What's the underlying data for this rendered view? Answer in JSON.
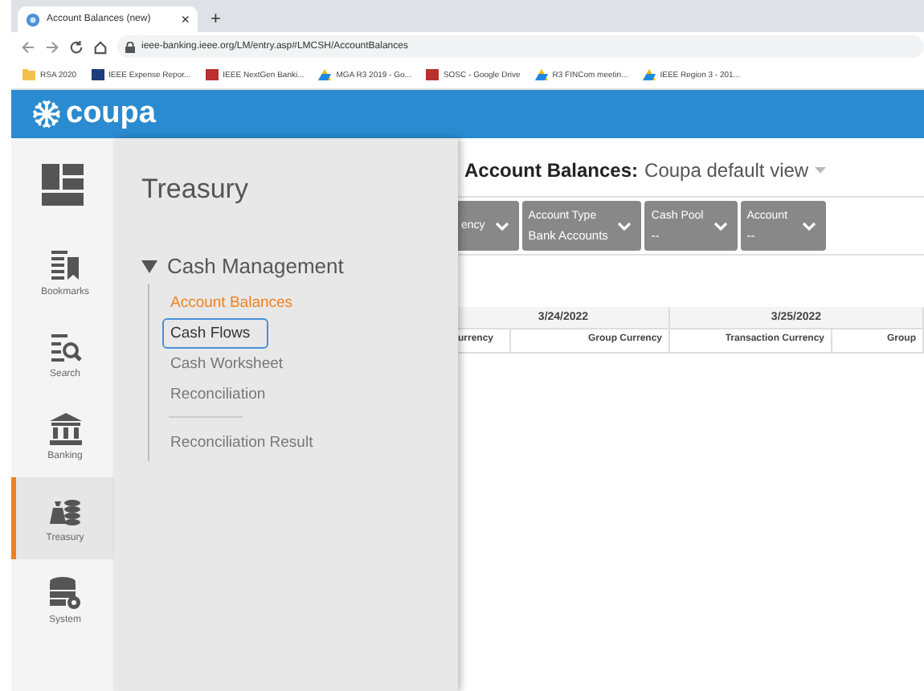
{
  "browser": {
    "tab_title": "Account Balances (new)",
    "tab_close": "×",
    "new_tab": "+",
    "url": "ieee-banking.ieee.org/LM/entry.asp#LMCSH/AccountBalances",
    "bookmarks": [
      {
        "label": "RSA 2020",
        "kind": "folder"
      },
      {
        "label": "IEEE Expense Repor...",
        "kind": "ieee"
      },
      {
        "label": "IEEE NextGen Banki...",
        "kind": "pdf"
      },
      {
        "label": "MGA R3 2019 - Go...",
        "kind": "drive"
      },
      {
        "label": "SOSC - Google Drive",
        "kind": "pdf"
      },
      {
        "label": "R3 FINCom meetin...",
        "kind": "drive"
      },
      {
        "label": "IEEE Region 3 - 201...",
        "kind": "drive"
      }
    ]
  },
  "header": {
    "logo": "coupa"
  },
  "sidebar": {
    "items": [
      {
        "label": "Bookmarks",
        "kind": "bookmarks",
        "selected": false
      },
      {
        "label": "Search",
        "kind": "search",
        "selected": false
      },
      {
        "label": "Banking",
        "kind": "bank",
        "selected": false
      },
      {
        "label": "Treasury",
        "kind": "treasury",
        "selected": true
      },
      {
        "label": "System",
        "kind": "system",
        "selected": false
      }
    ]
  },
  "menu_panel": {
    "title": "Treasury",
    "group": {
      "label": "Cash Management",
      "expanded": true,
      "items": [
        {
          "label": "Account Balances",
          "current": true,
          "selected": false,
          "divider_before": false
        },
        {
          "label": "Cash Flows",
          "current": false,
          "selected": true,
          "divider_before": false
        },
        {
          "label": "Cash Worksheet",
          "current": false,
          "selected": false,
          "divider_before": false
        },
        {
          "label": "Reconciliation",
          "current": false,
          "selected": false,
          "divider_before": false
        },
        {
          "label": "Reconciliation Result",
          "current": false,
          "selected": false,
          "divider_before": true
        }
      ]
    }
  },
  "content": {
    "title": "Account Balances:",
    "view": "Coupa default view",
    "filters": [
      {
        "label": "ency"
      },
      {
        "label": "Account Type",
        "value": "Bank Accounts"
      },
      {
        "label": "Cash Pool",
        "value": "--"
      },
      {
        "label": "Account",
        "value": "--"
      }
    ],
    "table": {
      "date_columns": [
        "3/24/2022",
        "3/25/2022"
      ],
      "columns": [
        "urrency",
        "Group Currency",
        "Transaction Currency",
        "Group"
      ]
    }
  }
}
